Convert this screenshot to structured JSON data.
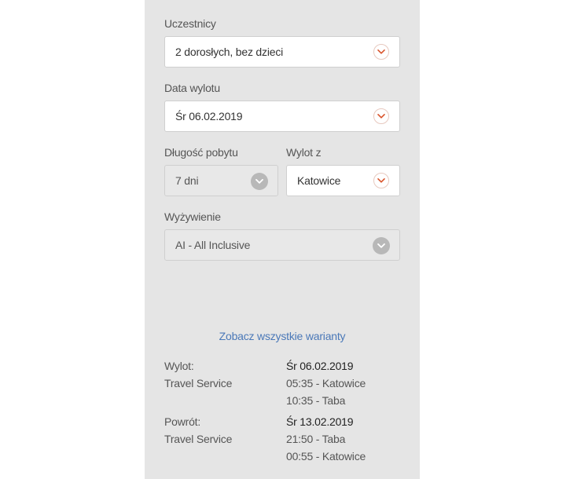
{
  "form": {
    "participants": {
      "label": "Uczestnicy",
      "value": "2 dorosłych, bez dzieci"
    },
    "departure_date": {
      "label": "Data wylotu",
      "value": "Śr 06.02.2019"
    },
    "duration": {
      "label": "Długość pobytu",
      "value": "7 dni"
    },
    "departure_from": {
      "label": "Wylot z",
      "value": "Katowice"
    },
    "board": {
      "label": "Wyżywienie",
      "value": "AI - All Inclusive"
    }
  },
  "variants_link": "Zobacz wszystkie warianty",
  "outbound": {
    "label": "Wylot:",
    "carrier": "Travel Service",
    "date": "Śr 06.02.2019",
    "depart": "05:35 - Katowice",
    "arrive": "10:35 - Taba"
  },
  "return": {
    "label": "Powrót:",
    "carrier": "Travel Service",
    "date": "Śr 13.02.2019",
    "depart": "21:50 - Taba",
    "arrive": "00:55 - Katowice"
  },
  "colors": {
    "panel_bg": "#e5e5e5",
    "link": "#4a78b8",
    "chevron_active": "#d9542b",
    "chevron_inactive": "#b8b8b8"
  },
  "icons": {
    "active_chevron": "chevron-down-icon",
    "inactive_chevron": "chevron-down-icon"
  }
}
